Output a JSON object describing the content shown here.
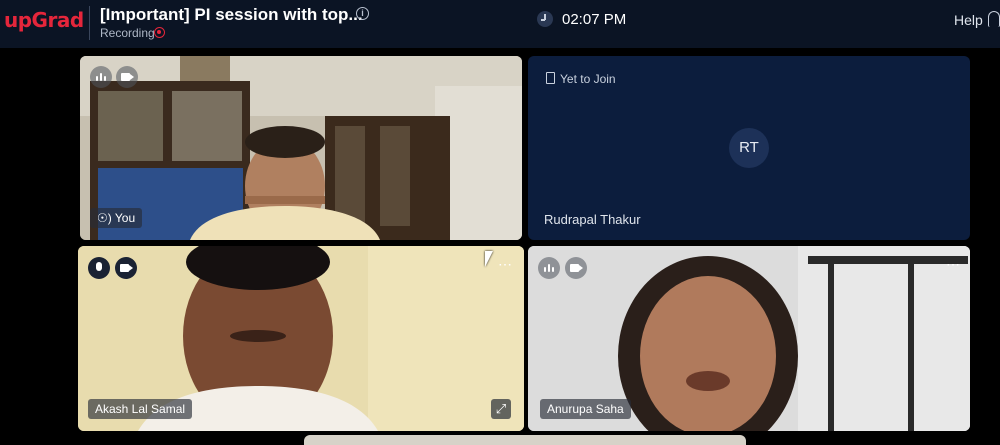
{
  "header": {
    "logo": "upGrad",
    "title": "[Important] PI session with top...",
    "recording_label": "Recording",
    "time": "02:07 PM",
    "help_label": "Help"
  },
  "participants": {
    "self": {
      "name": "You"
    },
    "rudrapal": {
      "status": "Yet to Join",
      "initials": "RT",
      "name": "Rudrapal Thakur"
    },
    "akash": {
      "name": "Akash Lal Samal"
    },
    "anurupa": {
      "name": "Anurupa Saha"
    }
  },
  "colors": {
    "brand": "#e5263b",
    "header_bg": "#0b1424",
    "tile_bg_dark": "#0c1d3d"
  }
}
